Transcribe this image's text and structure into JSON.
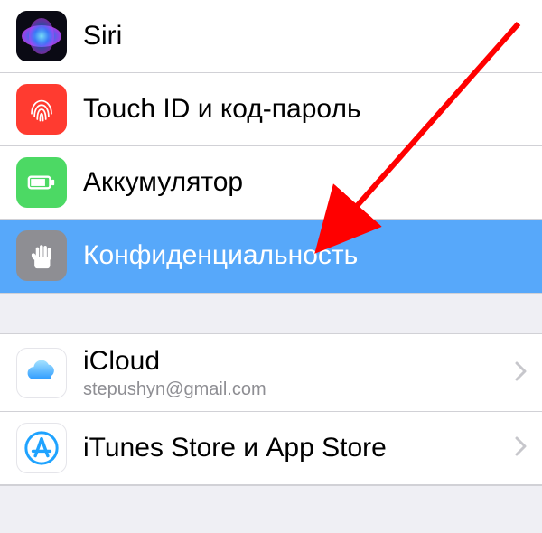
{
  "section1": {
    "items": [
      {
        "name": "siri",
        "label": "Siri"
      },
      {
        "name": "touchid",
        "label": "Touch ID и код-пароль"
      },
      {
        "name": "battery",
        "label": "Аккумулятор"
      },
      {
        "name": "privacy",
        "label": "Конфиденциальность",
        "highlighted": true
      }
    ]
  },
  "section2": {
    "items": [
      {
        "name": "icloud",
        "label": "iCloud",
        "detail": "stepushyn@gmail.com"
      },
      {
        "name": "itunes",
        "label": "iTunes Store и App Store"
      }
    ]
  },
  "colors": {
    "highlight": "#57a8fa",
    "touchid_bg": "#ff3b30",
    "battery_bg": "#4cd964",
    "privacy_bg": "#8e8e93",
    "appstore_blue": "#1fa3ff",
    "arrow": "#ff0000"
  }
}
